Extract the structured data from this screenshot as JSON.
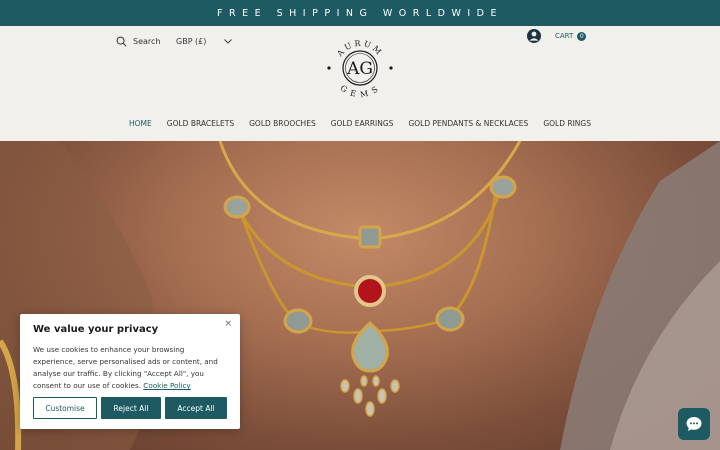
{
  "promo": {
    "text": "FREE SHIPPING WORLDWIDE"
  },
  "header": {
    "search_label": "Search",
    "currency": "GBP (£)",
    "logo": {
      "top_text": "AURUM",
      "bottom_text": "GEMS",
      "monogram": "AG"
    },
    "cart_label": "CART",
    "cart_count": "0"
  },
  "nav": {
    "items": [
      {
        "label": "HOME"
      },
      {
        "label": "GOLD BRACELETS"
      },
      {
        "label": "GOLD BROOCHES"
      },
      {
        "label": "GOLD EARRINGS"
      },
      {
        "label": "GOLD PENDANTS & NECKLACES"
      },
      {
        "label": "GOLD RINGS"
      }
    ]
  },
  "cookie": {
    "title": "We value your privacy",
    "body": "We use cookies to enhance your browsing experience, serve personalised ads or content, and analyse our traffic. By clicking \"Accept All\", you consent to our use of cookies.",
    "policy_link": "Cookie Policy",
    "close": "×",
    "customise": "Customise",
    "reject": "Reject All",
    "accept": "Accept All"
  },
  "colors": {
    "brand": "#1d5a61",
    "background": "#f2f0ec"
  }
}
